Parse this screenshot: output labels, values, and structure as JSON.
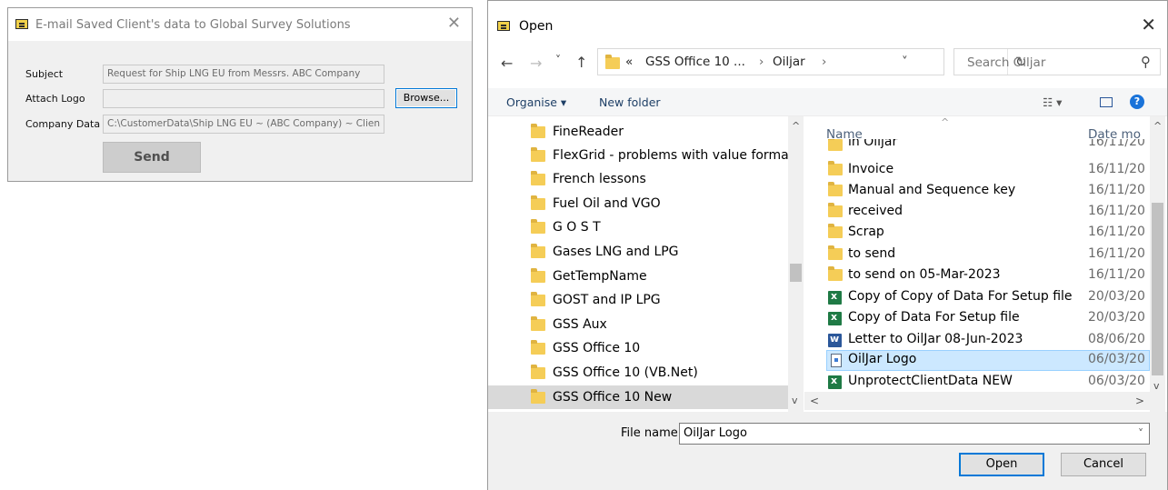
{
  "email_dialog": {
    "title": "E-mail Saved Client's data to Global Survey Solutions",
    "close_glyph": "✕",
    "subject_label": "Subject",
    "subject_value": "Request for Ship LNG EU from Messrs. ABC Company",
    "logo_label": "Attach Logo",
    "logo_value": "",
    "browse_label": "Browse...",
    "company_label": "Company Data",
    "company_value": "C:\\CustomerData\\Ship LNG EU ~ (ABC Company) ~ Clien",
    "send_label": "Send"
  },
  "open_dialog": {
    "title": "Open",
    "close_glyph": "✕",
    "nav": {
      "back": "←",
      "forward": "→",
      "recent": "˅",
      "up": "↑"
    },
    "address": {
      "prefix": "«",
      "segment1": "GSS Office 10 ...",
      "sep1": "›",
      "segment2": "Oiljar",
      "sep2": "›",
      "dropdown": "˅",
      "refresh": "↻"
    },
    "search_placeholder": "Search Oiljar",
    "search_icon": "⚲",
    "organise_label": "Organise ▾",
    "new_folder_label": "New folder",
    "view_glyph": "☷ ▾",
    "help_glyph": "?",
    "nav_items": [
      "FineReader",
      "FlexGrid - problems with value formats",
      "French lessons",
      "Fuel Oil and VGO",
      "G O S T",
      "Gases LNG and LPG",
      "GetTempName",
      "GOST and IP LPG",
      "GSS Aux",
      "GSS Office 10",
      "GSS Office 10 (VB.Net)",
      "GSS Office 10 New"
    ],
    "list_header": {
      "name": "Name",
      "date": "Date mo"
    },
    "files": [
      {
        "name": "in Oiljar",
        "date": "16/11/20",
        "icon": "folder"
      },
      {
        "name": "Invoice",
        "date": "16/11/20",
        "icon": "folder"
      },
      {
        "name": "Manual and Sequence key",
        "date": "16/11/20",
        "icon": "folder"
      },
      {
        "name": "received",
        "date": "16/11/20",
        "icon": "folder"
      },
      {
        "name": "Scrap",
        "date": "16/11/20",
        "icon": "folder"
      },
      {
        "name": "to send",
        "date": "16/11/20",
        "icon": "folder"
      },
      {
        "name": "to send on 05-Mar-2023",
        "date": "16/11/20",
        "icon": "folder"
      },
      {
        "name": "Copy of Copy of Data For Setup file",
        "date": "20/03/20",
        "icon": "excel"
      },
      {
        "name": "Copy of Data For Setup file",
        "date": "20/03/20",
        "icon": "excel"
      },
      {
        "name": "Letter to OilJar 08-Jun-2023",
        "date": "08/06/20",
        "icon": "word"
      },
      {
        "name": "OilJar Logo",
        "date": "06/03/20",
        "icon": "image"
      },
      {
        "name": "UnprotectClientData NEW",
        "date": "06/03/20",
        "icon": "excel"
      }
    ],
    "scroll": {
      "up": "^",
      "down": "v",
      "left": "<",
      "right": ">"
    },
    "file_name_label": "File name:",
    "file_name_value": "OilJar Logo",
    "open_label": "Open",
    "cancel_label": "Cancel"
  }
}
